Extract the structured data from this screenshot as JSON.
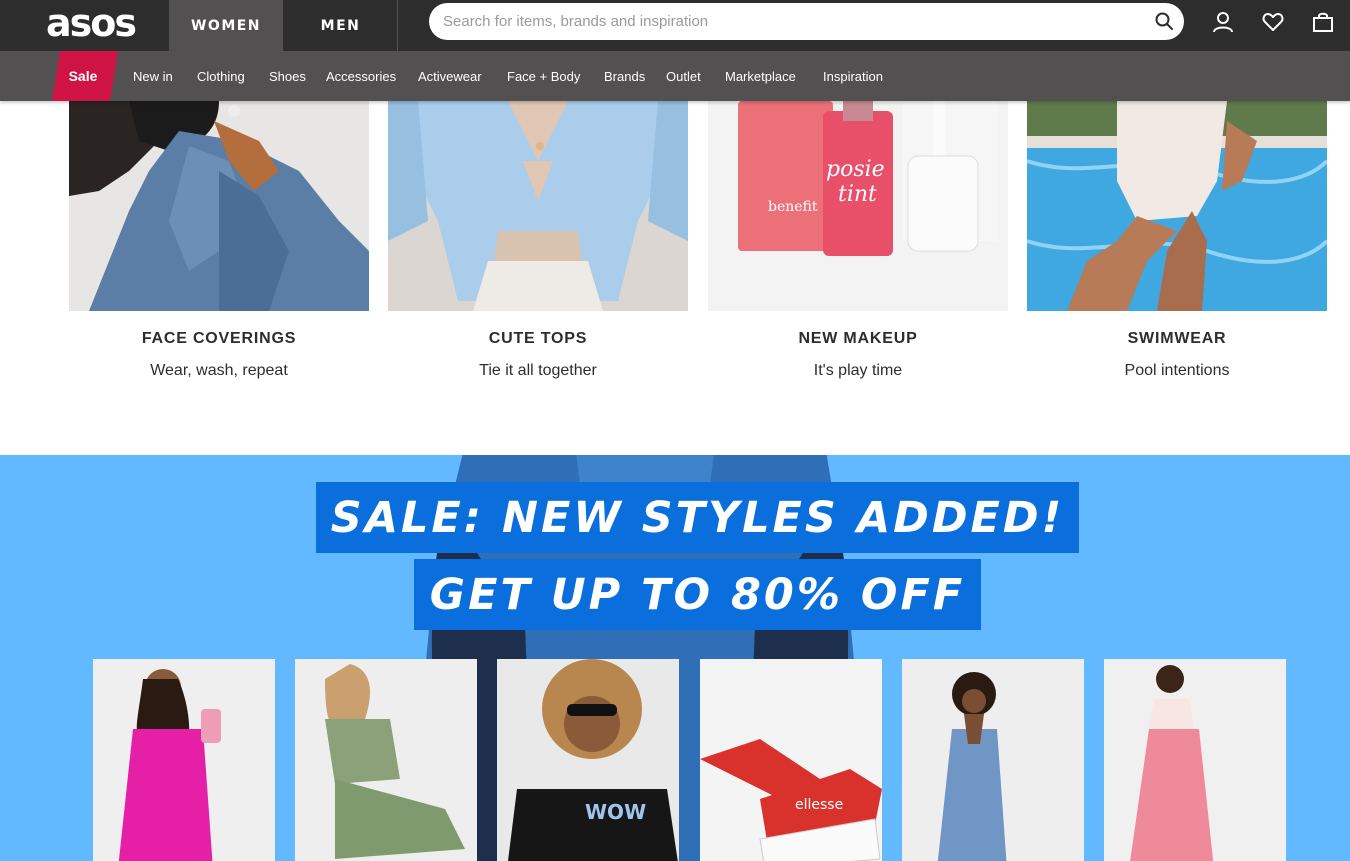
{
  "header": {
    "logo": "asos",
    "tabs": [
      {
        "label": "WOMEN",
        "active": true
      },
      {
        "label": "MEN",
        "active": false
      }
    ],
    "search": {
      "placeholder": "Search for items, brands and inspiration",
      "value": ""
    },
    "icons": [
      "account-icon",
      "heart-icon",
      "bag-icon"
    ]
  },
  "nav": {
    "sale_label": "Sale",
    "items": [
      "New in",
      "Clothing",
      "Shoes",
      "Accessories",
      "Activewear",
      "Face + Body",
      "Brands",
      "Outlet",
      "Marketplace",
      "Inspiration"
    ]
  },
  "tiles": [
    {
      "title": "FACE COVERINGS",
      "subtitle": "Wear, wash, repeat"
    },
    {
      "title": "CUTE TOPS",
      "subtitle": "Tie it all together"
    },
    {
      "title": "NEW MAKEUP",
      "subtitle": "It's play time"
    },
    {
      "title": "SWIMWEAR",
      "subtitle": "Pool intentions"
    }
  ],
  "sale_banner": {
    "line1": "SALE: NEW STYLES ADDED!",
    "line2": "GET UP TO 80% OFF"
  },
  "colors": {
    "header_bg": "#2d2d2d",
    "nav_bg": "#525050",
    "sale_red": "#d01345",
    "banner_bg": "#62b9ff",
    "banner_text_bg": "#0a6fdd"
  }
}
